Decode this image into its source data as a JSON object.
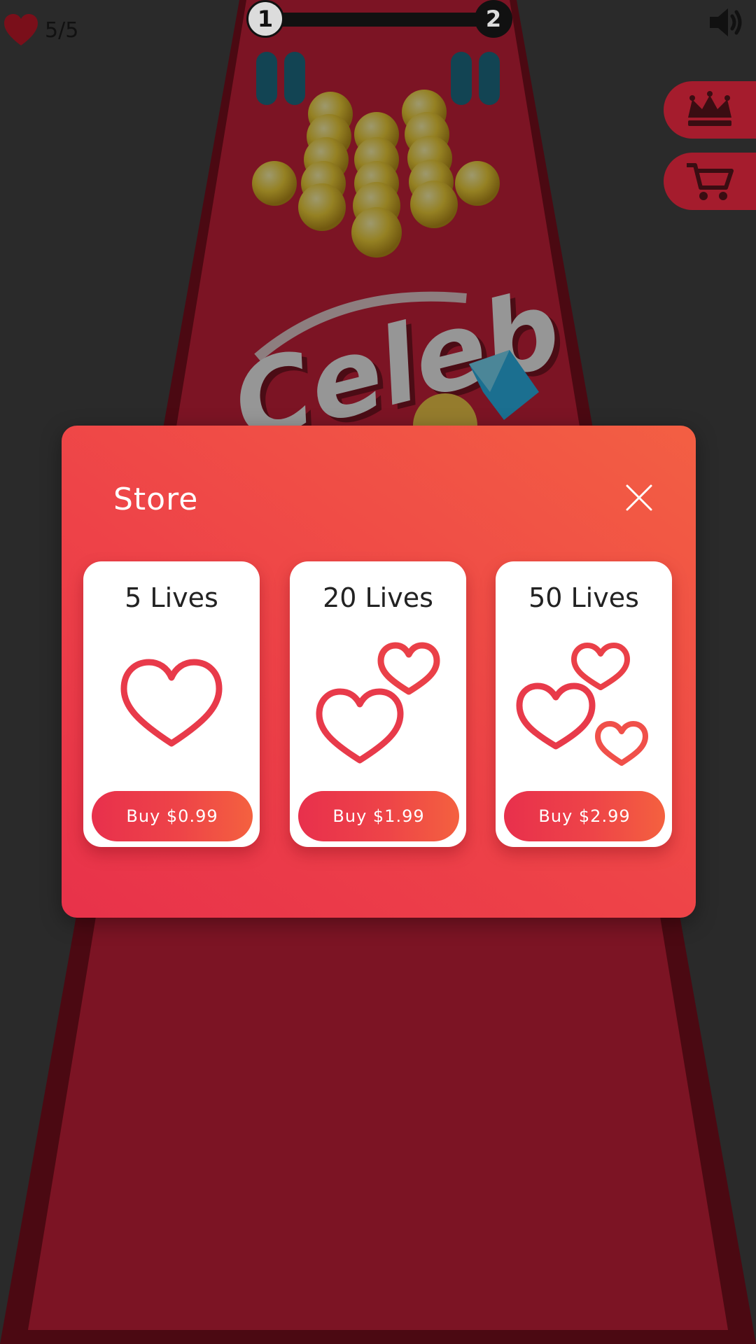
{
  "hud": {
    "lives": "5/5",
    "level_current": "1",
    "level_next": "2"
  },
  "store": {
    "title": "Store",
    "items": [
      {
        "title": "5 Lives",
        "button": "Buy $0.99"
      },
      {
        "title": "20 Lives",
        "button": "Buy $1.99"
      },
      {
        "title": "50 Lives",
        "button": "Buy $2.99"
      }
    ]
  },
  "background_logo": "Celeb",
  "icons": {
    "heart": "heart-icon",
    "sound": "speaker-icon",
    "crown": "crown-icon",
    "cart": "cart-icon",
    "close": "close-icon"
  },
  "colors": {
    "modal_start": "#e8324a",
    "modal_end": "#f35f43",
    "accent_red": "#e8304c",
    "track": "#c8213a"
  }
}
